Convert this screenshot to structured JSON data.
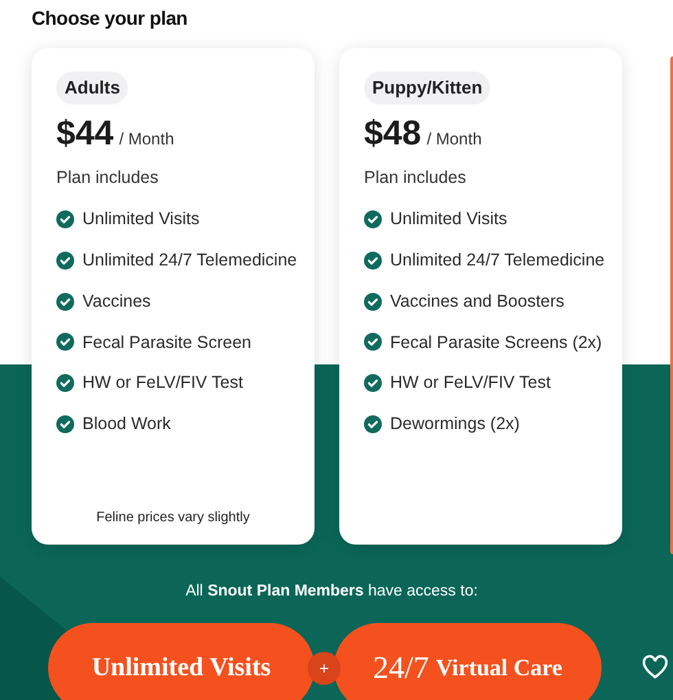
{
  "heading": "Choose your plan",
  "plans": [
    {
      "name": "Adults",
      "price": "$44",
      "period": "/ Month",
      "includes_label": "Plan includes",
      "features": [
        "Unlimited Visits",
        "Unlimited 24/7 Telemedicine",
        "Vaccines",
        "Fecal Parasite Screen",
        "HW or FeLV/FIV Test",
        "Blood Work"
      ],
      "note": "Feline prices vary slightly"
    },
    {
      "name": "Puppy/Kitten",
      "price": "$48",
      "period": "/ Month",
      "includes_label": "Plan includes",
      "features": [
        "Unlimited Visits",
        "Unlimited 24/7 Telemedicine",
        "Vaccines and Boosters",
        "Fecal Parasite Screens (2x)",
        "HW or FeLV/FIV Test",
        "Dewormings (2x)"
      ]
    }
  ],
  "access_text": "All **Snout Plan Members** have access to:",
  "perks": {
    "left": "Unlimited Visits",
    "joiner": "+",
    "right_number": "24/7",
    "right_text": "Virtual Care"
  }
}
